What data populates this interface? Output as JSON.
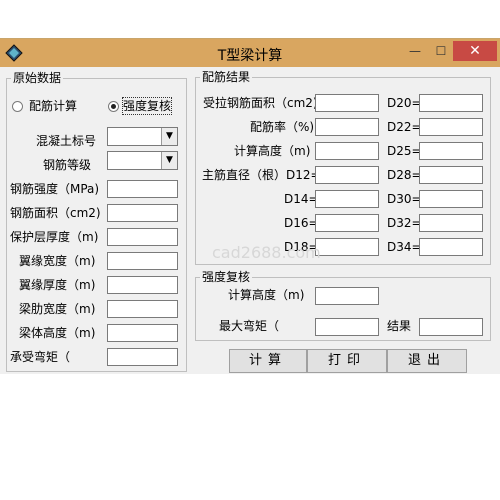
{
  "window": {
    "title": "T型梁计算",
    "minimize": "—",
    "maximize": "☐",
    "close": "✕"
  },
  "watermark": "cad2688.com",
  "original": {
    "group_title": "原始数据",
    "radio_design": "配筋计算",
    "radio_check": "强度复核",
    "selected_mode": "强度复核",
    "concrete_label": "混凝土标号",
    "steel_grade_label": "钢筋等级",
    "fields": [
      {
        "label": "钢筋强度（MPa)",
        "value": ""
      },
      {
        "label": "钢筋面积（cm2)",
        "value": ""
      },
      {
        "label": "保护层厚度（m)",
        "value": ""
      },
      {
        "label": "翼缘宽度（m)",
        "value": ""
      },
      {
        "label": "翼缘厚度（m)",
        "value": ""
      },
      {
        "label": "梁肋宽度（m)",
        "value": ""
      },
      {
        "label": "梁体高度（m)",
        "value": ""
      },
      {
        "label": "承受弯矩（",
        "value": ""
      }
    ]
  },
  "results": {
    "group_title": "配筋结果",
    "left": [
      {
        "label": "受拉钢筋面积（cm2)",
        "value": ""
      },
      {
        "label": "配筋率（%)",
        "value": ""
      },
      {
        "label": "计算高度（m)",
        "value": ""
      },
      {
        "label": "主筋直径（根）D12=",
        "value": ""
      },
      {
        "label": "D14=",
        "value": ""
      },
      {
        "label": "D16=",
        "value": ""
      },
      {
        "label": "D18=",
        "value": ""
      }
    ],
    "right": [
      {
        "label": "D20=",
        "value": ""
      },
      {
        "label": "D22=",
        "value": ""
      },
      {
        "label": "D25=",
        "value": ""
      },
      {
        "label": "D28=",
        "value": ""
      },
      {
        "label": "D30=",
        "value": ""
      },
      {
        "label": "D32=",
        "value": ""
      },
      {
        "label": "D34=",
        "value": ""
      }
    ]
  },
  "check": {
    "group_title": "强度复核",
    "calc_height_label": "计算高度（m)",
    "max_moment_label": "最大弯矩（",
    "result_label": "结果"
  },
  "buttons": {
    "calculate": "计算",
    "print": "打印",
    "exit": "退出"
  }
}
